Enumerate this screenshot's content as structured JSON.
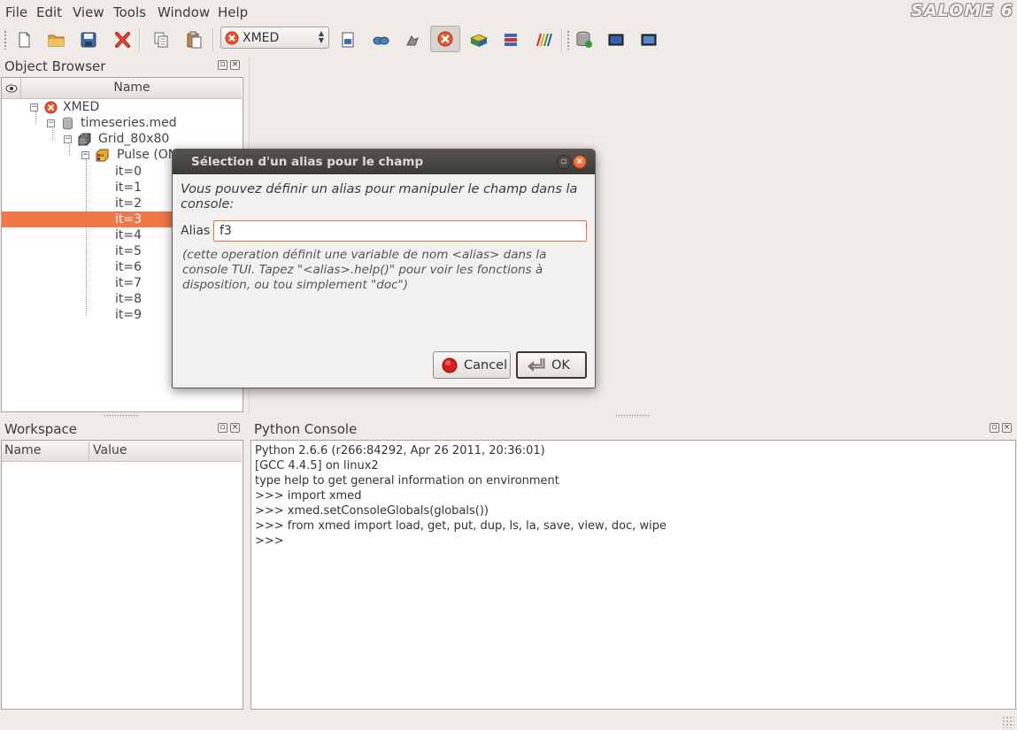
{
  "menubar": {
    "items": [
      {
        "label": "File"
      },
      {
        "label": "Edit"
      },
      {
        "label": "View"
      },
      {
        "label": "Tools"
      },
      {
        "label": "Window"
      },
      {
        "label": "Help"
      }
    ],
    "brand": "SALOME 6"
  },
  "toolbar": {
    "module_combo_value": "XMED",
    "icons": [
      "new-document-icon",
      "open-folder-icon",
      "save-icon",
      "close-study-icon",
      "copy-icon",
      "paste-icon",
      "dump-study-icon",
      "load-script-icon",
      "catalog-generator-icon",
      "xmed-module-icon",
      "geometry-module-icon",
      "mesh-module-icon",
      "post-pro-module-icon",
      "database-icon",
      "vtk-viewer-icon",
      "occ-viewer-icon"
    ]
  },
  "object_browser": {
    "title": "Object Browser",
    "column_name": "Name",
    "tree": [
      {
        "label": "XMED",
        "level": 0
      },
      {
        "label": "timeseries.med",
        "level": 1
      },
      {
        "label": "Grid_80x80",
        "level": 2
      },
      {
        "label": "Pulse (ON",
        "level": 3
      },
      {
        "label": "it=0",
        "level": 4
      },
      {
        "label": "it=1",
        "level": 4
      },
      {
        "label": "it=2",
        "level": 4
      },
      {
        "label": "it=3",
        "level": 4,
        "selected": true
      },
      {
        "label": "it=4",
        "level": 4
      },
      {
        "label": "it=5",
        "level": 4
      },
      {
        "label": "it=6",
        "level": 4
      },
      {
        "label": "it=7",
        "level": 4
      },
      {
        "label": "it=8",
        "level": 4
      },
      {
        "label": "it=9",
        "level": 4
      }
    ]
  },
  "workspace": {
    "title": "Workspace",
    "columns": [
      "Name",
      "Value"
    ]
  },
  "python_console": {
    "title": "Python Console",
    "lines": [
      "Python 2.6.6 (r266:84292, Apr 26 2011, 20:36:01)",
      "[GCC 4.4.5] on linux2",
      "type help to get general information on environment",
      ">>> import xmed",
      ">>> xmed.setConsoleGlobals(globals())",
      ">>> from xmed import load, get, put, dup, ls, la, save, view, doc, wipe",
      ">>>"
    ]
  },
  "dialog": {
    "title": "Sélection d'un alias pour le champ",
    "description": "Vous pouvez définir un alias pour manipuler le champ dans la console:",
    "alias_label": "Alias",
    "alias_value": "f3",
    "note": "(cette operation définit une variable de nom <alias> dans la console TUI. Tapez \"<alias>.help()\"  pour voir les fonctions à disposition, ou tou simplement \"doc\")",
    "cancel_label": "Cancel",
    "ok_label": "OK"
  },
  "colors": {
    "selection": "#f07746",
    "accent": "#e9703d",
    "title_bar": "#3c3b37"
  }
}
